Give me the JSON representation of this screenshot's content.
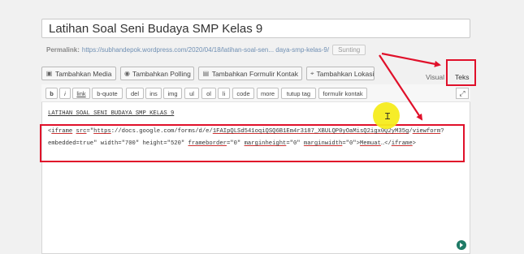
{
  "post": {
    "title": "Latihan Soal Seni Budaya SMP Kelas 9",
    "permalink_label": "Permalink:",
    "permalink_url": "https://subhandepok.wordpress.com/2020/04/18/latihan-soal-sen... daya-smp-kelas-9/",
    "permalink_button": "Sunting"
  },
  "media_buttons": [
    {
      "label": "Tambahkan Media",
      "icon": "media-icon"
    },
    {
      "label": "Tambahkan Polling",
      "icon": "poll-icon"
    },
    {
      "label": "Tambahkan Formulir Kontak",
      "icon": "form-icon"
    },
    {
      "label": "Tambahkan Lokasi",
      "icon": "location-icon"
    }
  ],
  "editor_tabs": {
    "visual": "Visual",
    "text": "Teks"
  },
  "quicktags": [
    "b",
    "i",
    "link",
    "b-quote",
    "del",
    "ins",
    "img",
    "ul",
    "ol",
    "li",
    "code",
    "more",
    "tutup tag",
    "formulir kontak"
  ],
  "content": {
    "heading": "LATIHAN SOAL SENI BUDAYA SMP KELAS 9",
    "iframe_line1_a": "<",
    "iframe_tag": "iframe",
    "iframe_line1_b": " ",
    "iframe_src_attr": "src",
    "iframe_line1_c": "=\"",
    "iframe_https": "https",
    "iframe_line1_d": "://docs.google.com/forms/d/e/",
    "iframe_form_id": "1FAIpQLSd541oqiQSQ6B1Em4r3187_XBULQP0yOaMisQ2igx0Q2yM35g",
    "iframe_line1_e": "/",
    "iframe_viewform": "viewform",
    "iframe_line1_f": "?",
    "iframe_line2_a": "embedded=true\" width=\"700\" height=\"520\" ",
    "iframe_frameborder": "frameborder",
    "iframe_line2_b": "=\"0\" ",
    "iframe_marginheight": "marginheight",
    "iframe_line2_c": "=\"0\" ",
    "iframe_marginwidth": "marginwidth",
    "iframe_line2_d": "=\"0\">",
    "iframe_loading": "Memuat",
    "iframe_line2_e": "…</",
    "iframe_close_tag": "iframe",
    "iframe_line2_f": ">"
  },
  "colors": {
    "annotation_red": "#e0102a",
    "highlight_yellow": "#f5ec1c"
  }
}
